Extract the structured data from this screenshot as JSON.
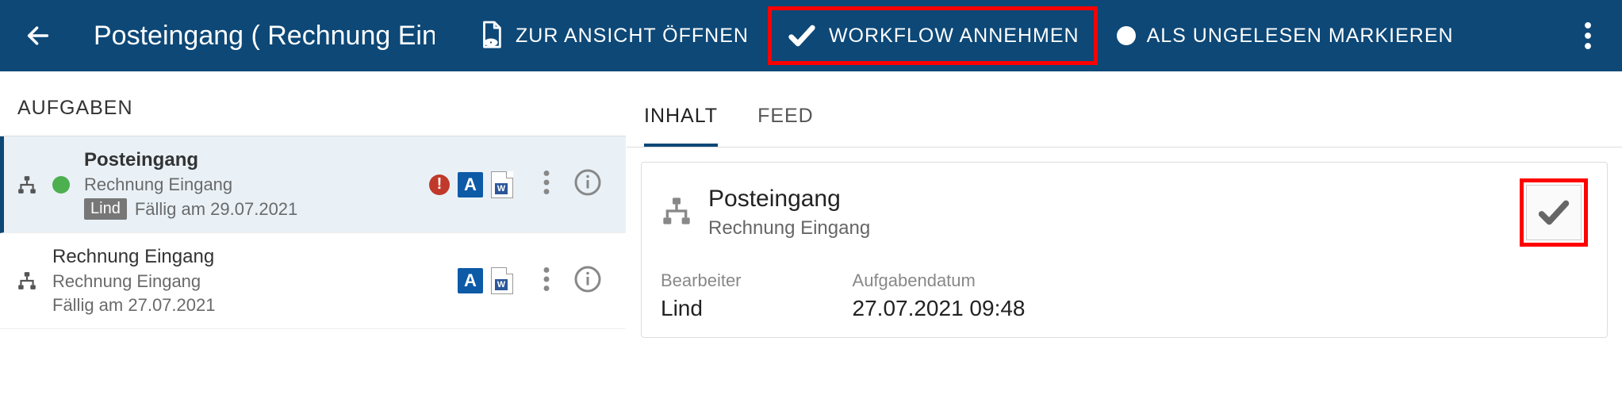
{
  "header": {
    "title": "Posteingang ( Rechnung Ein…",
    "actions": {
      "open_view": "ZUR ANSICHT ÖFFNEN",
      "accept_workflow": "WORKFLOW ANNEHMEN",
      "mark_unread": "ALS UNGELESEN MARKIEREN"
    }
  },
  "left": {
    "heading": "AUFGABEN",
    "items": [
      {
        "title": "Posteingang",
        "subtitle": "Rechnung Eingang",
        "assignee": "Lind",
        "due": "Fällig am 29.07.2021",
        "alert": true,
        "badge_a": "A",
        "has_doc": true,
        "selected": true,
        "unread": true
      },
      {
        "title": "Rechnung Eingang",
        "subtitle": "Rechnung Eingang",
        "assignee": "",
        "due": "Fällig am 27.07.2021",
        "alert": false,
        "badge_a": "A",
        "has_doc": true,
        "selected": false,
        "unread": false
      }
    ]
  },
  "right": {
    "tabs": {
      "content": "INHALT",
      "feed": "FEED"
    },
    "card": {
      "title": "Posteingang",
      "subtitle": "Rechnung Eingang",
      "fields": {
        "assignee_label": "Bearbeiter",
        "assignee_value": "Lind",
        "date_label": "Aufgabendatum",
        "date_value": "27.07.2021 09:48"
      }
    }
  }
}
